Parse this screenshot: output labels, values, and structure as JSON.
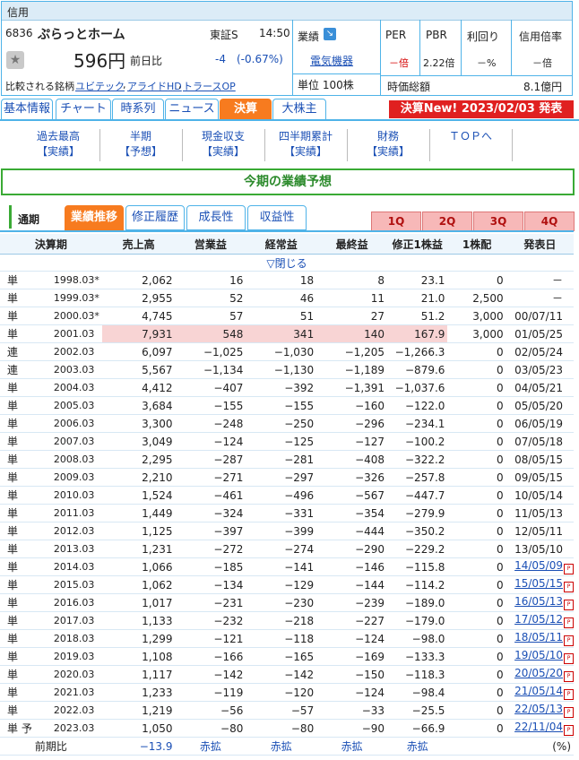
{
  "header": {
    "badge": "信用",
    "code": "6836",
    "company": "ぷらっとホーム",
    "market": "東証S",
    "time": "14:50",
    "price": "596円",
    "prev_label": "前日比",
    "change": "-4",
    "change_pct": "(-0.67%)",
    "compare_label": "比較される銘柄",
    "compare": [
      "ユビテック",
      "アライドHD",
      "トラースOP"
    ],
    "gyoseki_label": "業績",
    "sector": "電気機器",
    "unit": "単位 100株",
    "per_label": "PER",
    "per_value": "－倍",
    "pbr_label": "PBR",
    "pbr_value": "2.22倍",
    "yield_label": "利回り",
    "yield_value": "－%",
    "margin_label": "信用倍率",
    "margin_value": "－倍",
    "mcap_label": "時価総額",
    "mcap_value": "8.1億円"
  },
  "tabs": [
    "基本情報",
    "チャート",
    "時系列",
    "ニュース",
    "決算",
    "大株主"
  ],
  "kessan_new": "決算New! 2023/02/03 発表",
  "subnav": [
    {
      "l1": "過去最高",
      "l2": "【実績】"
    },
    {
      "l1": "半期",
      "l2": "【予想】"
    },
    {
      "l1": "現金収支",
      "l2": "【実績】"
    },
    {
      "l1": "四半期累計",
      "l2": "【実績】"
    },
    {
      "l1": "財務",
      "l2": "【実績】"
    },
    {
      "l1": "ＴＯＰへ",
      "l2": ""
    }
  ],
  "banner": "今期の業績予想",
  "inner_tabs": {
    "label": "通期",
    "items": [
      "業績推移",
      "修正履歴",
      "成長性",
      "収益性"
    ]
  },
  "quarters": [
    "1Q",
    "2Q",
    "3Q",
    "4Q"
  ],
  "table": {
    "headers": [
      "決算期",
      "売上高",
      "営業益",
      "経常益",
      "最終益",
      "修正1株益",
      "1株配",
      "発表日"
    ],
    "close_label": "▽閉じる",
    "rows": [
      [
        "単",
        "1998.03*",
        "2,062",
        "16",
        "18",
        "8",
        "23.1",
        "0",
        "－"
      ],
      [
        "単",
        "1999.03*",
        "2,955",
        "52",
        "46",
        "11",
        "21.0",
        "2,500",
        "－"
      ],
      [
        "単",
        "2000.03*",
        "4,745",
        "57",
        "51",
        "27",
        "51.2",
        "3,000",
        "00/07/11"
      ],
      [
        "単",
        "2001.03",
        "7,931",
        "548",
        "341",
        "140",
        "167.9",
        "3,000",
        "01/05/25"
      ],
      [
        "連",
        "2002.03",
        "6,097",
        "−1,025",
        "−1,030",
        "−1,205",
        "−1,266.3",
        "0",
        "02/05/24"
      ],
      [
        "連",
        "2003.03",
        "5,567",
        "−1,134",
        "−1,130",
        "−1,189",
        "−879.6",
        "0",
        "03/05/23"
      ],
      [
        "単",
        "2004.03",
        "4,412",
        "−407",
        "−392",
        "−1,391",
        "−1,037.6",
        "0",
        "04/05/21"
      ],
      [
        "単",
        "2005.03",
        "3,684",
        "−155",
        "−155",
        "−160",
        "−122.0",
        "0",
        "05/05/20"
      ],
      [
        "単",
        "2006.03",
        "3,300",
        "−248",
        "−250",
        "−296",
        "−234.1",
        "0",
        "06/05/19"
      ],
      [
        "単",
        "2007.03",
        "3,049",
        "−124",
        "−125",
        "−127",
        "−100.2",
        "0",
        "07/05/18"
      ],
      [
        "単",
        "2008.03",
        "2,295",
        "−287",
        "−281",
        "−408",
        "−322.2",
        "0",
        "08/05/15"
      ],
      [
        "単",
        "2009.03",
        "2,210",
        "−271",
        "−297",
        "−326",
        "−257.8",
        "0",
        "09/05/15"
      ],
      [
        "単",
        "2010.03",
        "1,524",
        "−461",
        "−496",
        "−567",
        "−447.7",
        "0",
        "10/05/14"
      ],
      [
        "単",
        "2011.03",
        "1,449",
        "−324",
        "−331",
        "−354",
        "−279.9",
        "0",
        "11/05/13"
      ],
      [
        "単",
        "2012.03",
        "1,125",
        "−397",
        "−399",
        "−444",
        "−350.2",
        "0",
        "12/05/11"
      ],
      [
        "単",
        "2013.03",
        "1,231",
        "−272",
        "−274",
        "−290",
        "−229.2",
        "0",
        "13/05/10"
      ],
      [
        "単",
        "2014.03",
        "1,066",
        "−185",
        "−141",
        "−146",
        "−115.8",
        "0",
        "14/05/09"
      ],
      [
        "単",
        "2015.03",
        "1,062",
        "−134",
        "−129",
        "−144",
        "−114.2",
        "0",
        "15/05/15"
      ],
      [
        "単",
        "2016.03",
        "1,017",
        "−231",
        "−230",
        "−239",
        "−189.0",
        "0",
        "16/05/13"
      ],
      [
        "単",
        "2017.03",
        "1,133",
        "−232",
        "−218",
        "−227",
        "−179.0",
        "0",
        "17/05/12"
      ],
      [
        "単",
        "2018.03",
        "1,299",
        "−121",
        "−118",
        "−124",
        "−98.0",
        "0",
        "18/05/11"
      ],
      [
        "単",
        "2019.03",
        "1,108",
        "−166",
        "−165",
        "−169",
        "−133.3",
        "0",
        "19/05/10"
      ],
      [
        "単",
        "2020.03",
        "1,117",
        "−142",
        "−142",
        "−150",
        "−118.3",
        "0",
        "20/05/20"
      ],
      [
        "単",
        "2021.03",
        "1,233",
        "−119",
        "−120",
        "−124",
        "−98.4",
        "0",
        "21/05/14"
      ],
      [
        "単",
        "2022.03",
        "1,219",
        "−56",
        "−57",
        "−33",
        "−25.5",
        "0",
        "22/05/13"
      ],
      [
        "単 予",
        "2023.03",
        "1,050",
        "−80",
        "−80",
        "−90",
        "−66.9",
        "0",
        "22/11/04"
      ]
    ],
    "footer": [
      "前期比",
      "−13.9",
      "赤拡",
      "赤拡",
      "赤拡",
      "赤拡",
      "",
      "(%)"
    ]
  }
}
